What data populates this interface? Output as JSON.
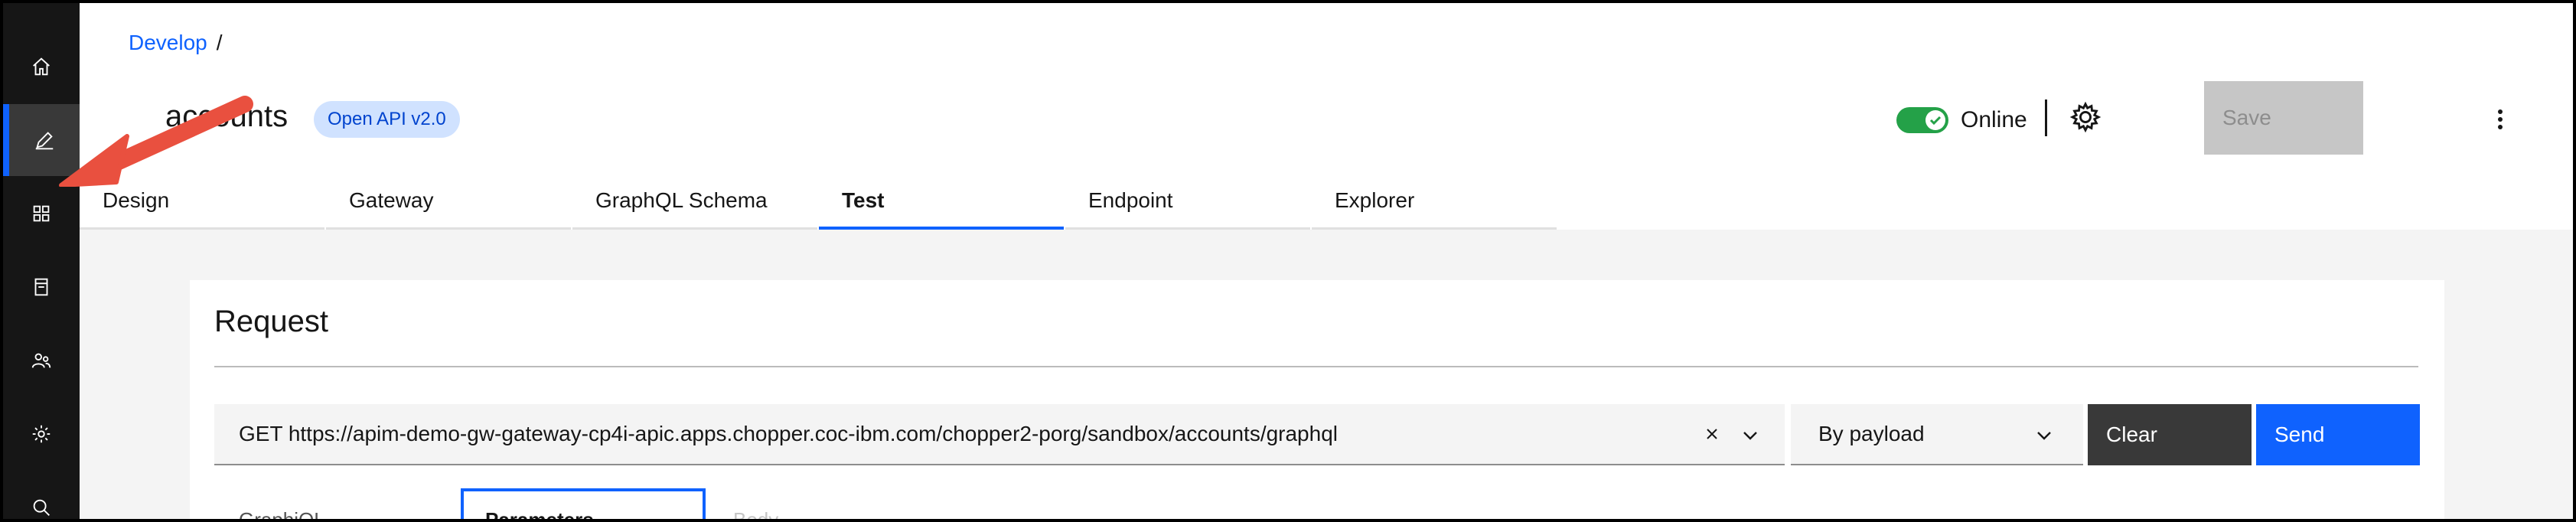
{
  "colors": {
    "accent": "#0f62fe",
    "online": "#24a148",
    "annotation": "#e9503f"
  },
  "sidebar": {
    "items": [
      {
        "icon": "home-icon"
      },
      {
        "icon": "edit-icon",
        "active": true
      },
      {
        "icon": "apps-icon"
      },
      {
        "icon": "catalog-icon"
      },
      {
        "icon": "users-icon"
      },
      {
        "icon": "settings-icon"
      },
      {
        "icon": "search-icon"
      }
    ]
  },
  "breadcrumb": {
    "root": "Develop",
    "separator": "/"
  },
  "header": {
    "title": "accounts",
    "badge": "Open API v2.0",
    "status_label": "Online",
    "save_label": "Save"
  },
  "tabs": [
    {
      "label": "Design"
    },
    {
      "label": "Gateway"
    },
    {
      "label": "GraphQL Schema"
    },
    {
      "label": "Test",
      "selected": true
    },
    {
      "label": "Endpoint"
    },
    {
      "label": "Explorer"
    }
  ],
  "request": {
    "title": "Request",
    "url": "GET https://apim-demo-gw-gateway-cp4i-apic.apps.chopper.coc-ibm.com/chopper2-porg/sandbox/accounts/graphql",
    "mode": "By payload",
    "clear_label": "Clear",
    "send_label": "Send",
    "subtabs": [
      "GraphiQL",
      "Parameters",
      "Body"
    ]
  }
}
